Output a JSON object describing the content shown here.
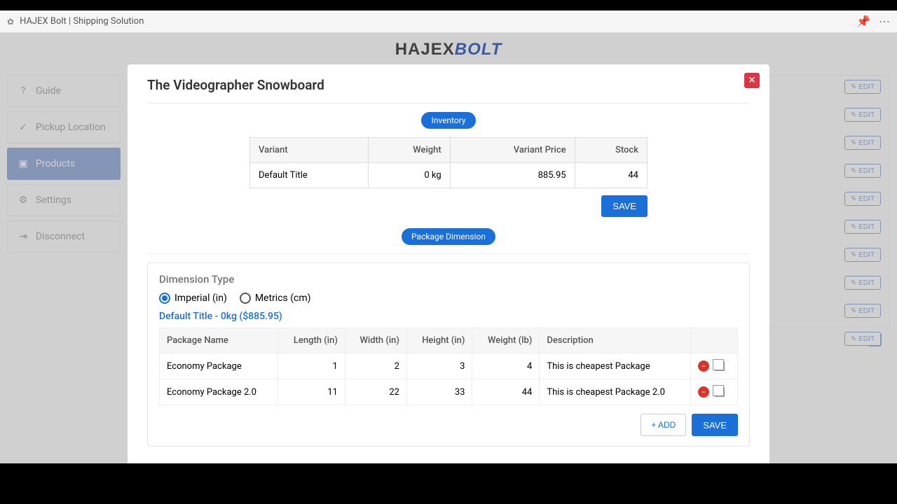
{
  "chrome": {
    "title": "HAJEX Bolt | Shipping Solution"
  },
  "logo": {
    "part1": "HAJEX",
    "part2": "BOLT"
  },
  "sidebar": {
    "items": [
      {
        "label": "Guide"
      },
      {
        "label": "Pickup Location"
      },
      {
        "label": "Products"
      },
      {
        "label": "Settings"
      },
      {
        "label": "Disconnect"
      }
    ]
  },
  "edit_label": "EDIT",
  "modal": {
    "title": "The Videographer Snowboard",
    "inventory_pill": "Inventory",
    "variant_headers": {
      "variant": "Variant",
      "weight": "Weight",
      "price": "Variant Price",
      "stock": "Stock"
    },
    "variant_row": {
      "name": "Default Title",
      "weight": "0 kg",
      "price": "885.95",
      "stock": "44"
    },
    "save": "SAVE",
    "dimension_pill": "Package Dimension",
    "dim_type_label": "Dimension Type",
    "unit_imperial": "Imperial (in)",
    "unit_metric": "Metrics (cm)",
    "variant_link": "Default Title - 0kg ($885.95)",
    "pkg_headers": {
      "name": "Package Name",
      "length": "Length (in)",
      "width": "Width (in)",
      "height": "Height (in)",
      "weight": "Weight (lb)",
      "desc": "Description"
    },
    "packages": [
      {
        "name": "Economy Package",
        "length": "1",
        "width": "2",
        "height": "3",
        "weight": "4",
        "desc": "This is cheapest Package"
      },
      {
        "name": "Economy Package 2.0",
        "length": "11",
        "width": "22",
        "height": "33",
        "weight": "44",
        "desc": "This is cheapest Package 2.0"
      }
    ],
    "add": "+ ADD"
  }
}
